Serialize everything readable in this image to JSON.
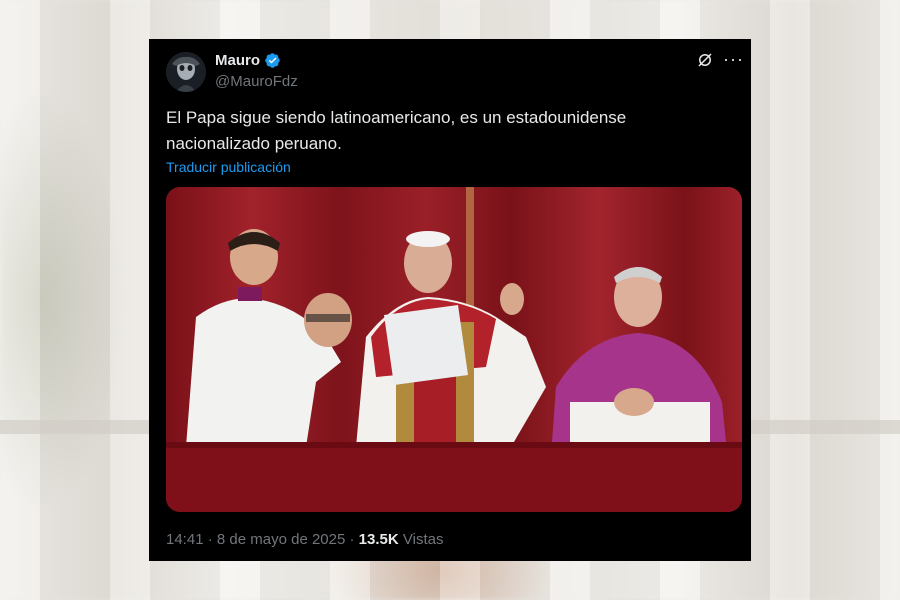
{
  "tweet": {
    "display_name": "Mauro",
    "handle": "@MauroFdz",
    "text_line1": "El Papa sigue siendo latinoamericano, es un estadounidense",
    "text_line2": "nacionalizado peruano.",
    "translate_link": "Traducir publicación",
    "time": "14:41",
    "separator1": " · ",
    "date": "8 de mayo de 2025",
    "separator2": " · ",
    "views_count": "13.5K",
    "views_label": "Vistas"
  },
  "icons": {
    "verified": "verified-badge-icon",
    "grok": "grok-icon",
    "more": "more-options-icon"
  },
  "colors": {
    "background": "#000000",
    "text": "#e7e9ea",
    "secondary": "#71767b",
    "link": "#1d9bf0",
    "verified": "#1d9bf0"
  }
}
